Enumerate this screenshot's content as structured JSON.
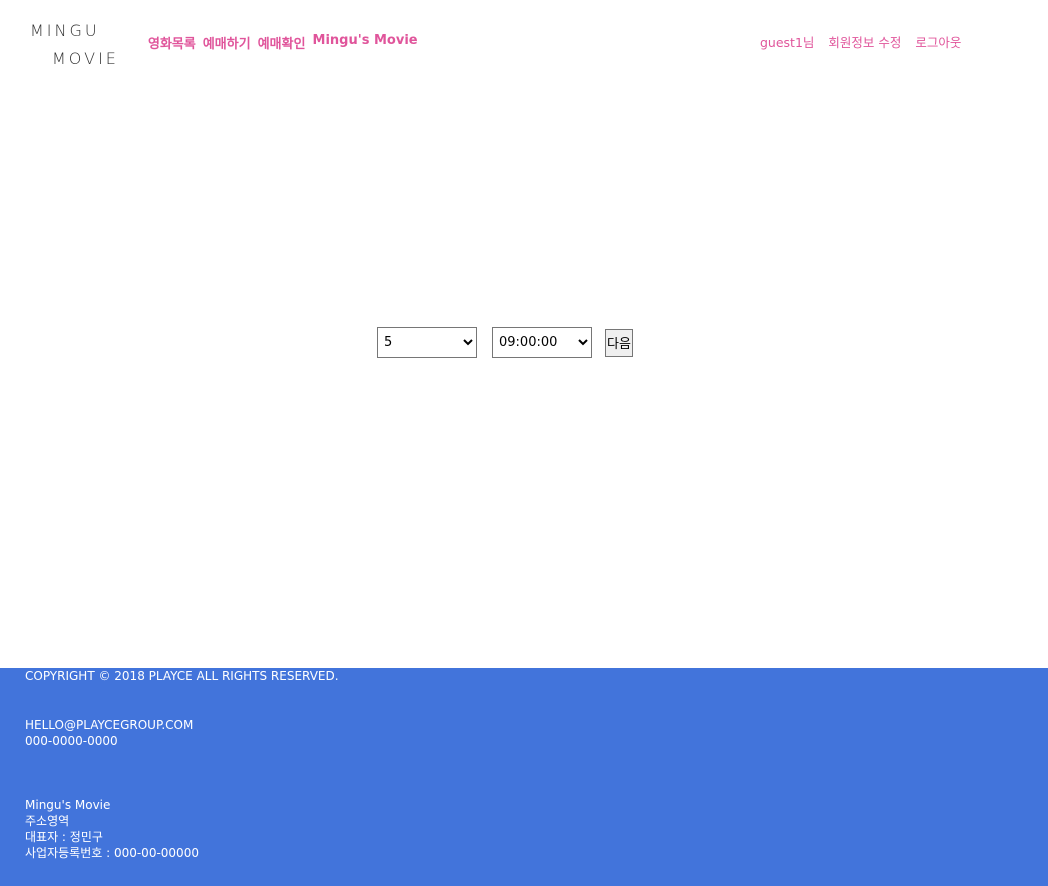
{
  "brand": {
    "logo_line1": "MINGU",
    "logo_line2": "MOVIE"
  },
  "main_nav": {
    "movies": "영화목록",
    "reserve": "예매하기",
    "reserve_check": "예매확인",
    "site_name": "Mingu's Movie"
  },
  "user_nav": {
    "greeting": "guest1님",
    "edit_profile": "회원정보 수정",
    "logout": "로그아웃"
  },
  "form": {
    "number_selected": "5",
    "time_selected": "09:00:00",
    "next_label": "다음"
  },
  "footer": {
    "copyright": "COPYRIGHT © 2018 PLAYCE ALL RIGHTS RESERVED.",
    "email": "HELLO@PLAYCEGROUP.COM",
    "phone": "000-0000-0000",
    "company_name": "Mingu's Movie",
    "address": "주소영역",
    "ceo": "대표자 : 정민구",
    "business_number": "사업자등록번호 : 000-00-00000"
  },
  "colors": {
    "accent_pink": "#e0559b",
    "footer_blue": "#4274db"
  }
}
